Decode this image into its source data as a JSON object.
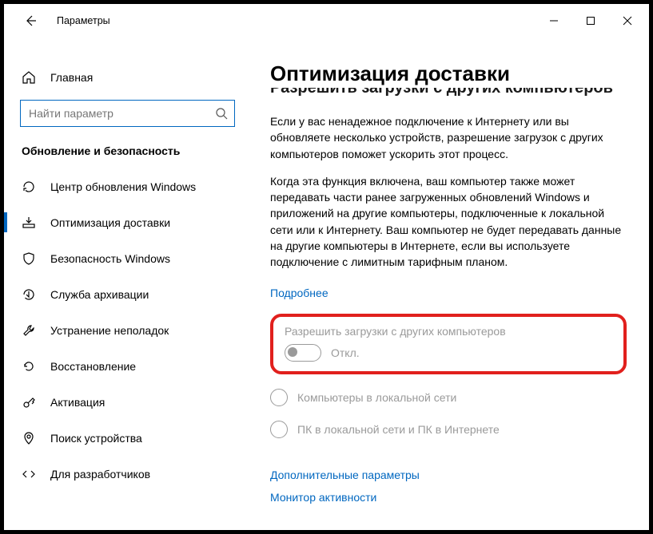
{
  "window": {
    "title": "Параметры"
  },
  "sidebar": {
    "home": "Главная",
    "search_placeholder": "Найти параметр",
    "group": "Обновление и безопасность",
    "items": [
      {
        "label": "Центр обновления Windows"
      },
      {
        "label": "Оптимизация доставки"
      },
      {
        "label": "Безопасность Windows"
      },
      {
        "label": "Служба архивации"
      },
      {
        "label": "Устранение неполадок"
      },
      {
        "label": "Восстановление"
      },
      {
        "label": "Активация"
      },
      {
        "label": "Поиск устройства"
      },
      {
        "label": "Для разработчиков"
      }
    ]
  },
  "main": {
    "heading": "Оптимизация доставки",
    "para1": "Если у вас ненадежное подключение к Интернету или вы обновляете несколько устройств, разрешение загрузок с других компьютеров поможет ускорить этот процесс.",
    "para2": "Когда эта функция включена, ваш компьютер также может передавать части ранее загруженных обновлений Windows и приложений на другие компьютеры, подключенные к локальной сети или к Интернету. Ваш компьютер не будет передавать данные на другие компьютеры в Интернете, если вы используете подключение с лимитным тарифным планом.",
    "learn_more": "Подробнее",
    "toggle_label": "Разрешить загрузки с других компьютеров",
    "toggle_state": "Откл.",
    "radio1": "Компьютеры в локальной сети",
    "radio2": "ПК в локальной сети и ПК в Интернете",
    "advanced": "Дополнительные параметры",
    "monitor": "Монитор активности"
  }
}
